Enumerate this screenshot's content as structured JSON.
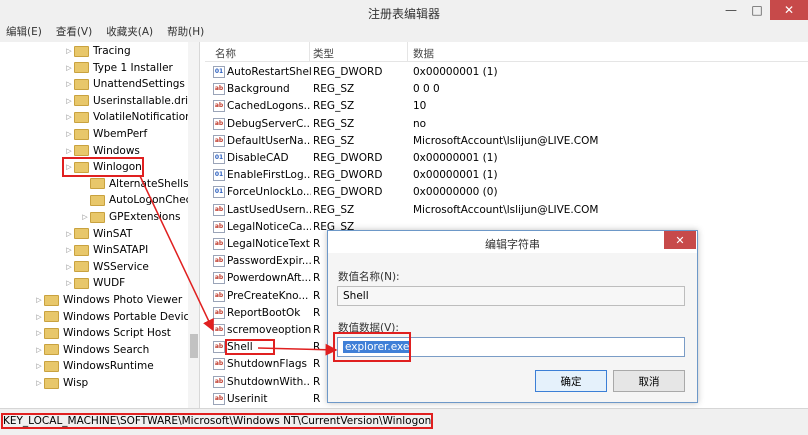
{
  "window": {
    "title": "注册表编辑器",
    "minimize": "—",
    "maximize": "□",
    "close": "✕"
  },
  "menu": [
    "编辑(E)",
    "查看(V)",
    "收藏夹(A)",
    "帮助(H)"
  ],
  "tree": [
    {
      "label": "Tracing",
      "indent": 1,
      "expand": true
    },
    {
      "label": "Type 1 Installer",
      "indent": 1,
      "expand": true
    },
    {
      "label": "UnattendSettings",
      "indent": 1,
      "expand": true
    },
    {
      "label": "Userinstallable.drive",
      "indent": 1,
      "expand": true
    },
    {
      "label": "VolatileNotifications",
      "indent": 1,
      "expand": true
    },
    {
      "label": "WbemPerf",
      "indent": 1,
      "expand": true
    },
    {
      "label": "Windows",
      "indent": 1,
      "expand": true
    },
    {
      "label": "Winlogon",
      "indent": 1,
      "expand": true,
      "highlight": true
    },
    {
      "label": "AlternateShells",
      "indent": 2,
      "expand": false
    },
    {
      "label": "AutoLogonCheck",
      "indent": 2,
      "expand": false
    },
    {
      "label": "GPExtensions",
      "indent": 2,
      "expand": true
    },
    {
      "label": "WinSAT",
      "indent": 1,
      "expand": true
    },
    {
      "label": "WinSATAPI",
      "indent": 1,
      "expand": true
    },
    {
      "label": "WSService",
      "indent": 1,
      "expand": true
    },
    {
      "label": "WUDF",
      "indent": 1,
      "expand": true
    },
    {
      "label": "Windows Photo Viewer",
      "indent": 0,
      "expand": true
    },
    {
      "label": "Windows Portable Devices",
      "indent": 0,
      "expand": true
    },
    {
      "label": "Windows Script Host",
      "indent": 0,
      "expand": true
    },
    {
      "label": "Windows Search",
      "indent": 0,
      "expand": true
    },
    {
      "label": "WindowsRuntime",
      "indent": 0,
      "expand": true
    },
    {
      "label": "Wisp",
      "indent": 0,
      "expand": true
    }
  ],
  "list": {
    "headers": {
      "name": "名称",
      "type": "类型",
      "data": "数据"
    },
    "rows": [
      {
        "icon": "bin",
        "name": "AutoRestartShell",
        "type": "REG_DWORD",
        "data": "0x00000001 (1)"
      },
      {
        "icon": "sz",
        "name": "Background",
        "type": "REG_SZ",
        "data": "0 0 0"
      },
      {
        "icon": "sz",
        "name": "CachedLogons...",
        "type": "REG_SZ",
        "data": "10"
      },
      {
        "icon": "sz",
        "name": "DebugServerC...",
        "type": "REG_SZ",
        "data": "no"
      },
      {
        "icon": "sz",
        "name": "DefaultUserNa...",
        "type": "REG_SZ",
        "data": "MicrosoftAccount\\lslijun@LIVE.COM"
      },
      {
        "icon": "bin",
        "name": "DisableCAD",
        "type": "REG_DWORD",
        "data": "0x00000001 (1)"
      },
      {
        "icon": "bin",
        "name": "EnableFirstLog...",
        "type": "REG_DWORD",
        "data": "0x00000001 (1)"
      },
      {
        "icon": "bin",
        "name": "ForceUnlockLo...",
        "type": "REG_DWORD",
        "data": "0x00000000 (0)"
      },
      {
        "icon": "sz",
        "name": "LastUsedUsern...",
        "type": "REG_SZ",
        "data": "MicrosoftAccount\\lslijun@LIVE.COM"
      },
      {
        "icon": "sz",
        "name": "LegalNoticeCa...",
        "type": "REG_SZ",
        "data": ""
      },
      {
        "icon": "sz",
        "name": "LegalNoticeText",
        "type": "R",
        "data": ""
      },
      {
        "icon": "sz",
        "name": "PasswordExpir...",
        "type": "R",
        "data": ""
      },
      {
        "icon": "sz",
        "name": "PowerdownAft...",
        "type": "R",
        "data": ""
      },
      {
        "icon": "sz",
        "name": "PreCreateKno...",
        "type": "R",
        "data": ""
      },
      {
        "icon": "sz",
        "name": "ReportBootOk",
        "type": "R",
        "data": ""
      },
      {
        "icon": "sz",
        "name": "scremoveoption",
        "type": "R",
        "data": ""
      },
      {
        "icon": "sz",
        "name": "Shell",
        "type": "R",
        "data": "",
        "highlight": true
      },
      {
        "icon": "sz",
        "name": "ShutdownFlags",
        "type": "R",
        "data": ""
      },
      {
        "icon": "sz",
        "name": "ShutdownWith...",
        "type": "R",
        "data": ""
      },
      {
        "icon": "sz",
        "name": "Userinit",
        "type": "R",
        "data": ""
      }
    ]
  },
  "status": {
    "path": "KEY_LOCAL_MACHINE\\SOFTWARE\\Microsoft\\Windows NT\\CurrentVersion\\Winlogon"
  },
  "dialog": {
    "title": "编辑字符串",
    "close": "✕",
    "name_label": "数值名称(N):",
    "name_value": "Shell",
    "data_label": "数值数据(V):",
    "data_value": "explorer.exe",
    "ok": "确定",
    "cancel": "取消"
  },
  "colors": {
    "highlight": "#e02020",
    "selection": "#3f7fd7",
    "close": "#c74a4a"
  }
}
